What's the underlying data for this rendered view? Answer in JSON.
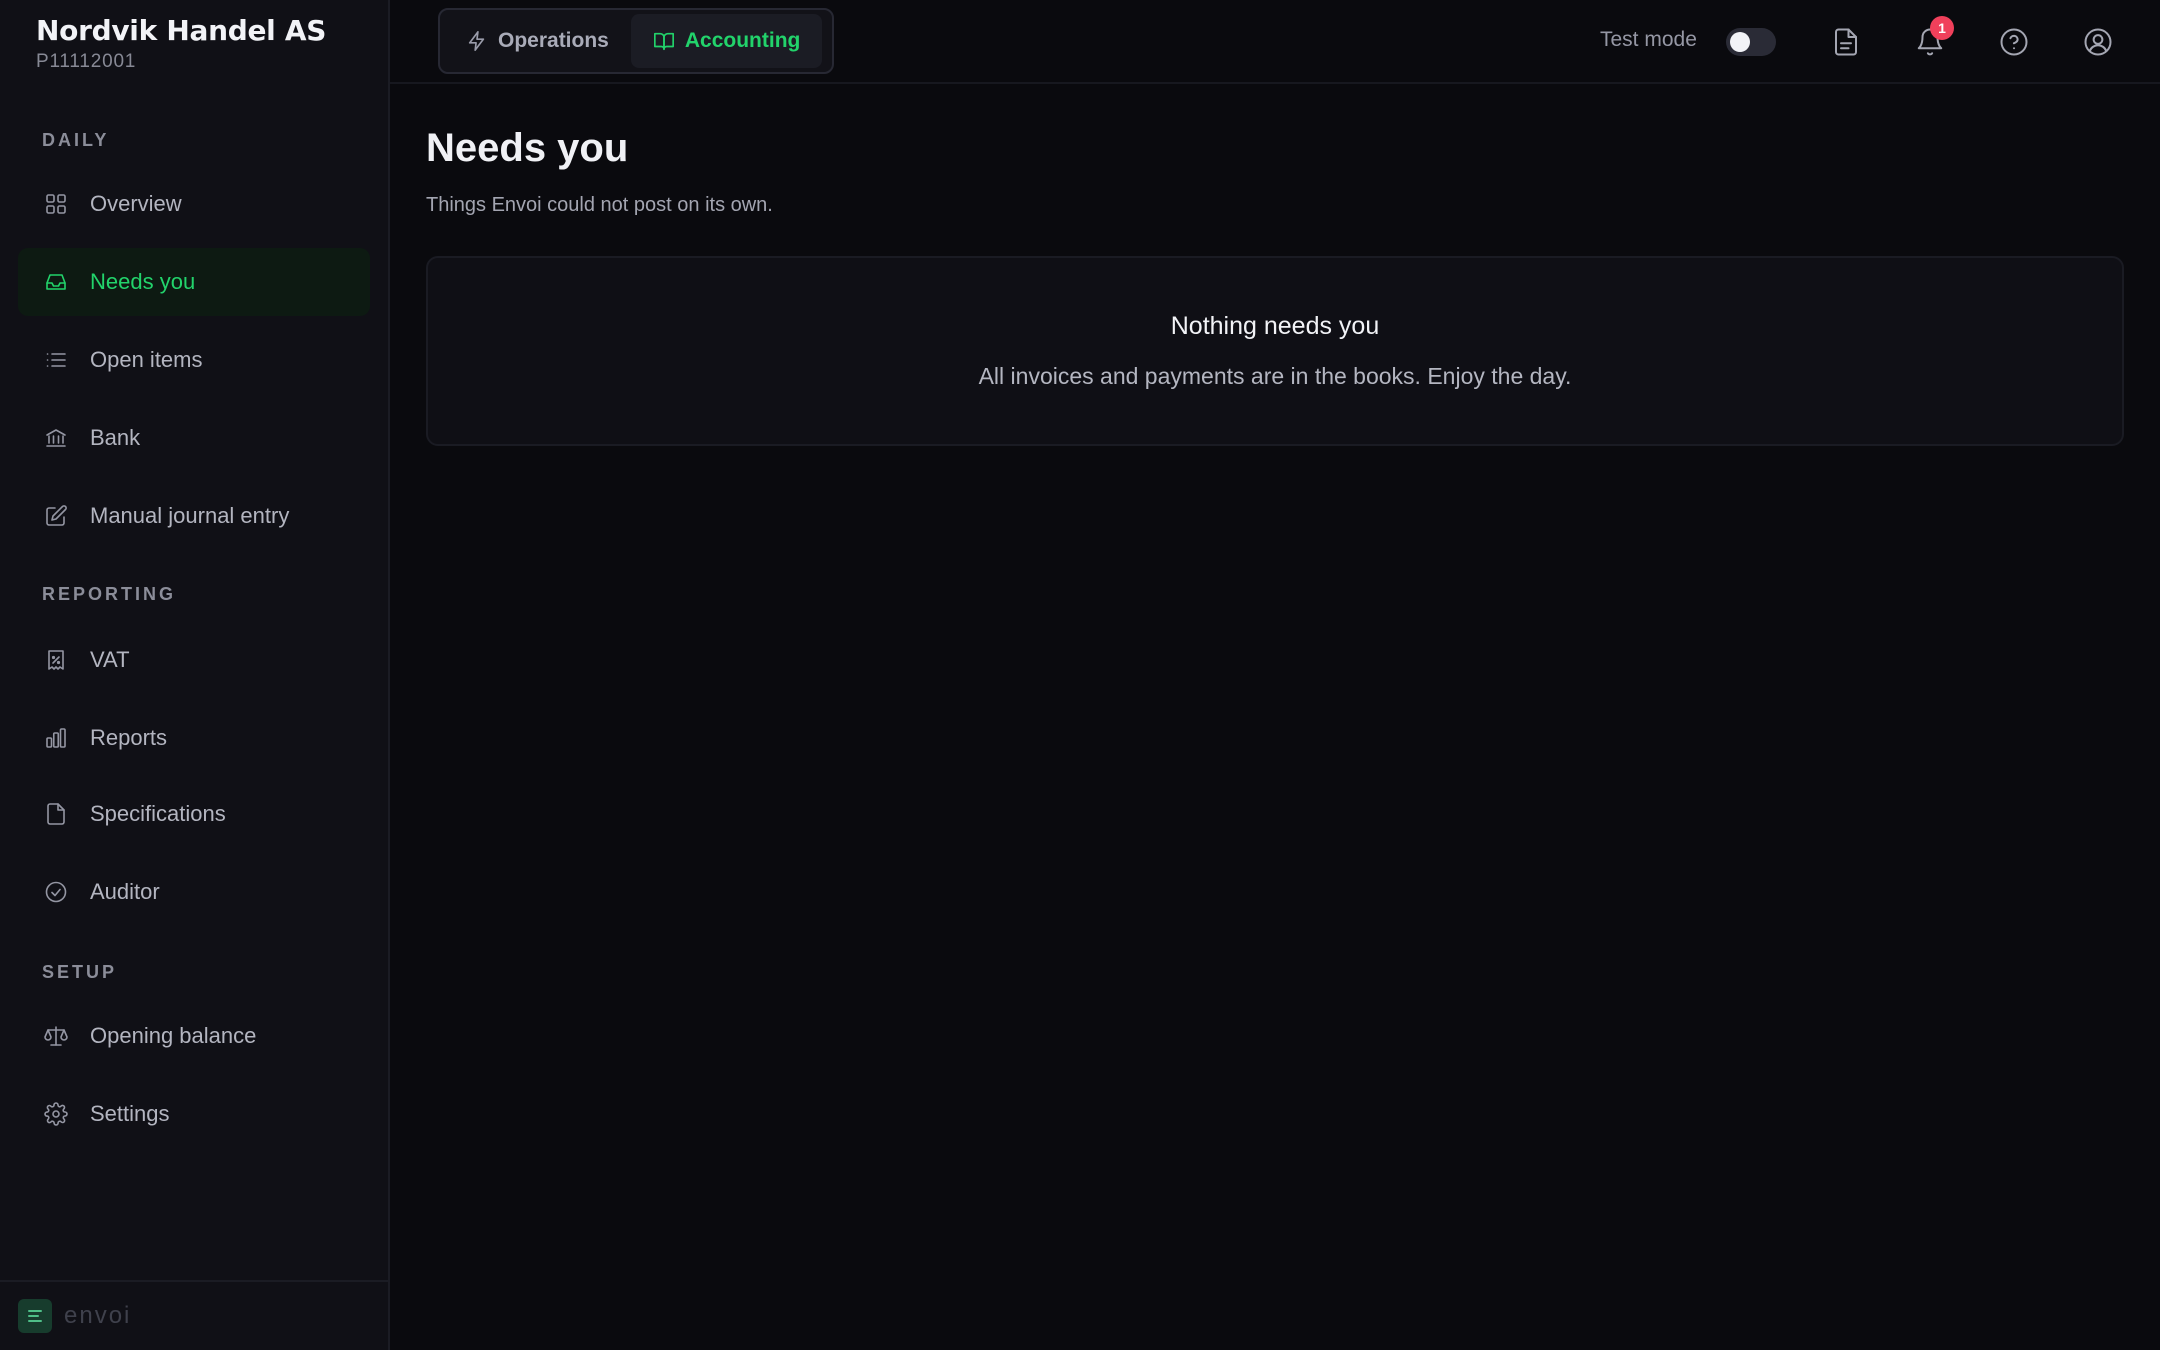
{
  "company": {
    "name": "Nordvik Handel AS",
    "id": "P11112001"
  },
  "sidebar": {
    "sections": [
      {
        "label": "DAILY"
      },
      {
        "label": "REPORTING"
      },
      {
        "label": "SETUP"
      }
    ],
    "items": [
      {
        "label": "Overview",
        "icon": "grid-icon"
      },
      {
        "label": "Needs you",
        "icon": "inbox-icon",
        "active": true
      },
      {
        "label": "Open items",
        "icon": "list-icon"
      },
      {
        "label": "Bank",
        "icon": "bank-icon"
      },
      {
        "label": "Manual journal entry",
        "icon": "edit-icon"
      },
      {
        "label": "VAT",
        "icon": "receipt-percent-icon"
      },
      {
        "label": "Reports",
        "icon": "bar-chart-icon"
      },
      {
        "label": "Specifications",
        "icon": "file-icon"
      },
      {
        "label": "Auditor",
        "icon": "check-circle-icon"
      },
      {
        "label": "Opening balance",
        "icon": "scale-icon"
      },
      {
        "label": "Settings",
        "icon": "gear-icon"
      }
    ],
    "footer_brand": "envoi"
  },
  "topbar": {
    "tabs": [
      {
        "label": "Operations",
        "icon": "lightning-icon"
      },
      {
        "label": "Accounting",
        "icon": "book-icon",
        "active": true
      }
    ],
    "test_mode_label": "Test mode",
    "test_mode_on": false,
    "notification_count": "1"
  },
  "main": {
    "title": "Needs you",
    "subtitle": "Things Envoi could not post on its own.",
    "empty_title": "Nothing needs you",
    "empty_text": "All invoices and payments are in the books. Enjoy the day."
  },
  "colors": {
    "accent": "#22d36b",
    "badge": "#f0405b",
    "background": "#0a0a0e"
  }
}
